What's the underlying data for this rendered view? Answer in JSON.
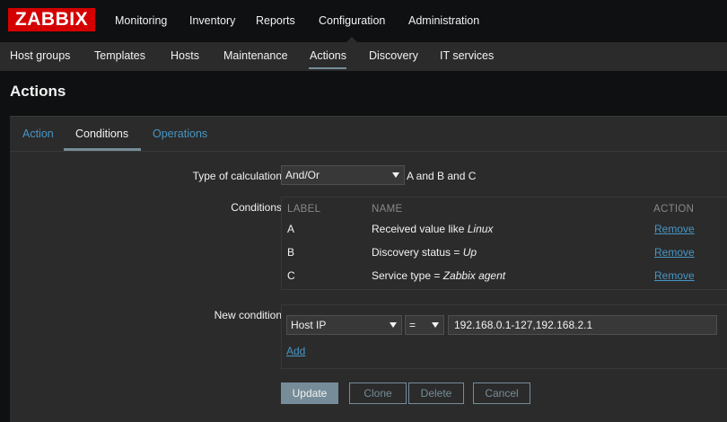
{
  "app": {
    "logo": "ZABBIX"
  },
  "topnav": [
    "Monitoring",
    "Inventory",
    "Reports",
    "Configuration",
    "Administration"
  ],
  "subnav": [
    "Host groups",
    "Templates",
    "Hosts",
    "Maintenance",
    "Actions",
    "Discovery",
    "IT services"
  ],
  "page": {
    "title": "Actions"
  },
  "tabs": [
    "Action",
    "Conditions",
    "Operations"
  ],
  "form": {
    "calc_label": "Type of calculation",
    "calc_value": "And/Or",
    "calc_formula": "A and B and C",
    "conditions_label": "Conditions",
    "table_headers": {
      "label": "LABEL",
      "name": "NAME",
      "action": "ACTION"
    },
    "conditions": [
      {
        "label": "A",
        "name_prefix": "Received value like ",
        "name_value": "Linux",
        "action": "Remove"
      },
      {
        "label": "B",
        "name_prefix": "Discovery status = ",
        "name_value": "Up",
        "action": "Remove"
      },
      {
        "label": "C",
        "name_prefix": "Service type = ",
        "name_value": "Zabbix agent",
        "action": "Remove"
      }
    ],
    "new_condition_label": "New condition",
    "new_condition_type": "Host IP",
    "new_condition_operator": "=",
    "new_condition_value": "192.168.0.1-127,192.168.2.1",
    "add_label": "Add"
  },
  "buttons": {
    "update": "Update",
    "clone": "Clone",
    "delete": "Delete",
    "cancel": "Cancel"
  },
  "colors": {
    "logo_red": "#d40000",
    "link_blue": "#4796c4",
    "accent": "#768d99",
    "panel": "#2b2b2b",
    "background": "#0e1012"
  }
}
